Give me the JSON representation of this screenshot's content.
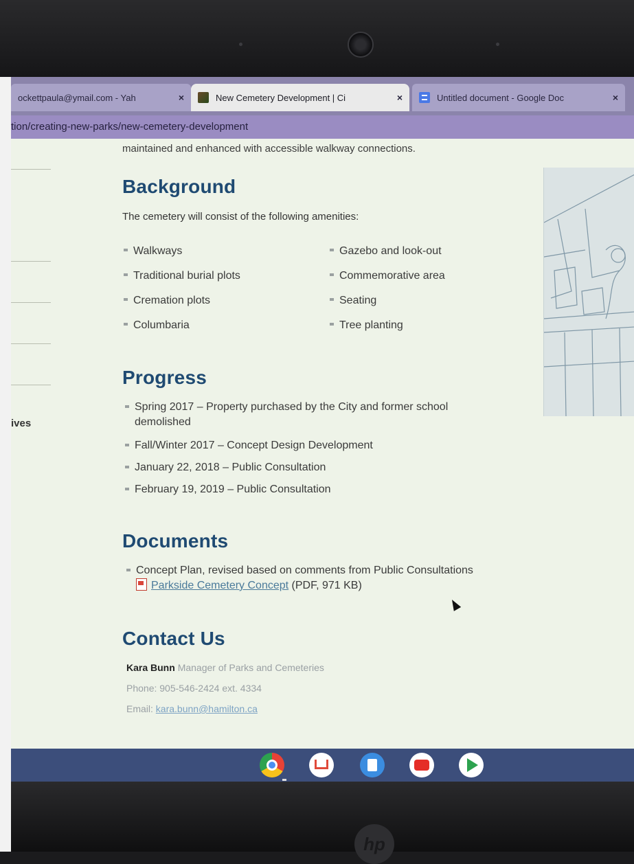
{
  "browser": {
    "tabs": [
      {
        "title": "ockettpaula@ymail.com - Yah",
        "state": "inactive"
      },
      {
        "title": "New Cemetery Development | Ci",
        "state": "active"
      },
      {
        "title": "Untitled document - Google Doc",
        "state": "inactive"
      }
    ],
    "close_glyph": "×",
    "url": "tion/creating-new-parks/new-cemetery-development"
  },
  "sidebar": {
    "partial_label": "ives"
  },
  "content": {
    "intro": "maintained and enhanced with accessible walkway connections.",
    "background": {
      "heading": "Background",
      "text": "The cemetery will consist of the following amenities:",
      "amenities_left": [
        "Walkways",
        "Traditional burial plots",
        "Cremation plots",
        "Columbaria"
      ],
      "amenities_right": [
        "Gazebo and look-out",
        "Commemorative area",
        "Seating",
        "Tree planting"
      ]
    },
    "progress": {
      "heading": "Progress",
      "items": [
        "Spring 2017 – Property purchased by the City and former school",
        "Fall/Winter 2017 – Concept Design Development",
        "January 22, 2018 – Public Consultation",
        "February 19, 2019 – Public Consultation"
      ],
      "item_1_continuation": "demolished"
    },
    "documents": {
      "heading": "Documents",
      "item": "Concept Plan, revised based on comments from Public Consultations",
      "link_text": "Parkside Cemetery Concept",
      "link_meta": "(PDF, 971 KB)"
    },
    "contact": {
      "heading": "Contact Us",
      "name": "Kara Bunn",
      "role": "Manager of Parks and Cemeteries",
      "phone": "Phone: 905-546-2424 ext. 4334",
      "email_label": "Email:",
      "email": "kara.bunn@hamilton.ca"
    }
  },
  "shelf": {
    "apps": [
      "chrome-icon",
      "gmail-icon",
      "files-icon",
      "youtube-icon",
      "play-store-icon"
    ]
  },
  "device": {
    "logo": "hp"
  },
  "colors": {
    "heading": "#1f4a72",
    "tabstrip": "#8b84ab",
    "shelf": "#3c4e7b"
  }
}
